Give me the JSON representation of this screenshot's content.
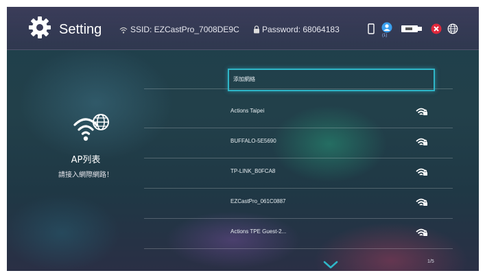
{
  "header": {
    "title": "Setting",
    "ssid_text": "SSID: EZCastPro_7008DE9C",
    "password_text": "Password: 68064183",
    "connected_count": "(1)"
  },
  "left_panel": {
    "title": "AP列表",
    "subtitle": "請接入網際網路！"
  },
  "networks": [
    {
      "label": "添加網絡"
    },
    {
      "label": "Actions Taipei"
    },
    {
      "label": "BUFFALO-5E5690"
    },
    {
      "label": "TP-LINK_B0FCA8"
    },
    {
      "label": "EZCastPro_061C0887"
    },
    {
      "label": "Actions TPE Guest-2..."
    }
  ],
  "pager": "1/5",
  "colors": {
    "accent": "#2fb6c8",
    "header_bg": "#3c3c5a",
    "close_red": "#e0283c",
    "user_blue": "#3aa0f0"
  },
  "icons": [
    "gear-icon",
    "wifi-ssid-icon",
    "lock-icon",
    "phone-icon",
    "users-icon",
    "adapter-icon",
    "close-icon",
    "globe-icon",
    "wifi-globe-icon",
    "wifi-lock-icon",
    "chevron-down-icon"
  ]
}
